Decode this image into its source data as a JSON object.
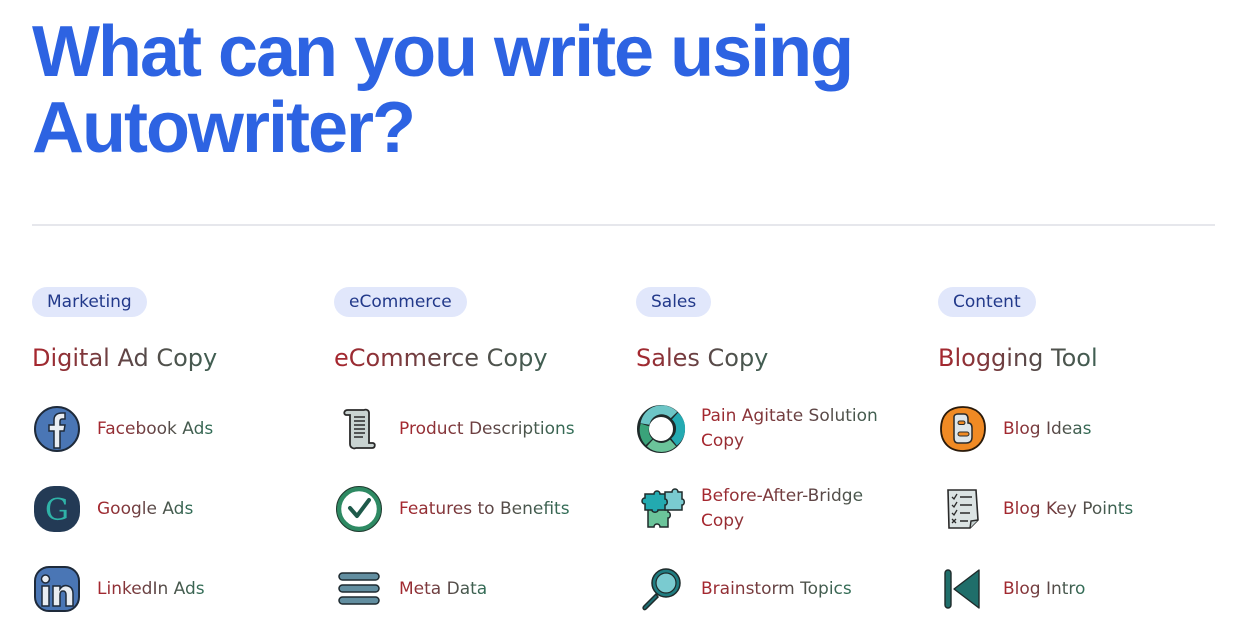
{
  "page": {
    "title": "What can you write using Autowriter?"
  },
  "colors": {
    "title": "#2d63e2",
    "pill_bg": "#e1e7fb",
    "pill_text": "#22398a",
    "label_gradient_start": "#a8262e",
    "label_gradient_end": "#2f6e56",
    "divider": "#e6e7ec"
  },
  "categories": [
    {
      "tag": "Marketing",
      "title": "Digital Ad Copy",
      "tools": [
        {
          "label": "Facebook Ads",
          "icon": "facebook-icon"
        },
        {
          "label": "Google Ads",
          "icon": "google-icon"
        },
        {
          "label": "LinkedIn Ads",
          "icon": "linkedin-icon"
        }
      ]
    },
    {
      "tag": "eCommerce",
      "title": "eCommerce Copy",
      "tools": [
        {
          "label": "Product Descriptions",
          "icon": "scroll-icon"
        },
        {
          "label": "Features to Benefits",
          "icon": "check-circle-icon"
        },
        {
          "label": "Meta Data",
          "icon": "menu-lines-icon"
        }
      ]
    },
    {
      "tag": "Sales",
      "title": "Sales Copy",
      "tools": [
        {
          "label": "Pain Agitate Solution Copy",
          "icon": "cycle-arrows-icon"
        },
        {
          "label": "Before-After-Bridge Copy",
          "icon": "puzzle-icon"
        },
        {
          "label": "Brainstorm Topics",
          "icon": "magnifier-icon"
        }
      ]
    },
    {
      "tag": "Content",
      "title": "Blogging Tool",
      "tools": [
        {
          "label": "Blog Ideas",
          "icon": "blogger-icon"
        },
        {
          "label": "Blog Key Points",
          "icon": "checklist-icon"
        },
        {
          "label": "Blog Intro",
          "icon": "skip-back-icon"
        }
      ]
    }
  ]
}
